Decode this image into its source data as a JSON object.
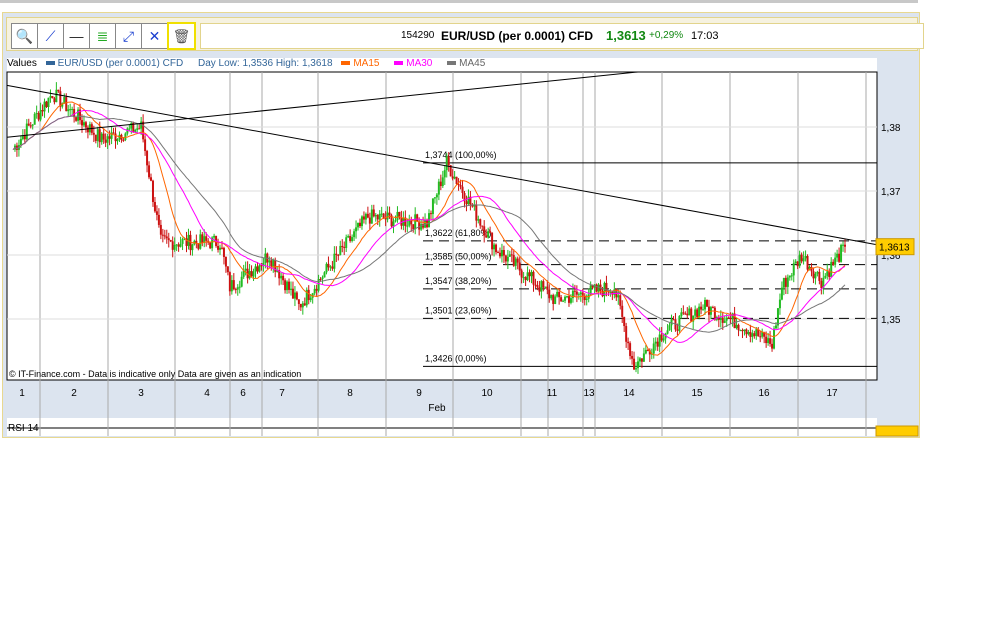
{
  "toolbar": {
    "buttons": [
      "zoom-in",
      "draw-trendline",
      "horizontal-line",
      "fibonacci",
      "parallel-channel",
      "crossing-lines",
      "delete"
    ]
  },
  "quote": {
    "id": "154290",
    "symbol": "EUR/USD (per 0.0001) CFD",
    "price": "1,3613",
    "change": "+0,29%",
    "time": "17:03"
  },
  "legend": {
    "label": "Values",
    "series": "EUR/USD (per 0.0001) CFD",
    "day_low_high": "Day Low: 1,3536 High: 1,3618",
    "ma15": "MA15",
    "ma30": "MA30",
    "ma45": "MA45"
  },
  "colors": {
    "up": "#22bb22",
    "down": "#cc1111",
    "ma15": "#ff6600",
    "ma30": "#ff00ff",
    "ma45": "#777777",
    "series": "#336699"
  },
  "chart_data": {
    "type": "candlestick",
    "title": "EUR/USD (per 0.0001) CFD",
    "ylim": [
      1.3405,
      1.3895
    ],
    "y_ticks": [
      "1,38",
      "1,37",
      "1,36",
      "1,35"
    ],
    "y_tick_values": [
      1.38,
      1.37,
      1.36,
      1.35
    ],
    "x_ticks": [
      "1",
      "2",
      "3",
      "4",
      "6",
      "7",
      "8",
      "9",
      "10",
      "11",
      "13",
      "14",
      "15",
      "16",
      "17"
    ],
    "x_month": "Feb",
    "last_price_label": "1,3613",
    "last_price": 1.3613,
    "price_path": [
      [
        0,
        1.3765
      ],
      [
        20,
        1.3853
      ],
      [
        45,
        1.378
      ],
      [
        65,
        1.38
      ],
      [
        75,
        1.362
      ],
      [
        105,
        1.362
      ],
      [
        110,
        1.355
      ],
      [
        130,
        1.36
      ],
      [
        145,
        1.352
      ],
      [
        165,
        1.36
      ],
      [
        180,
        1.366
      ],
      [
        210,
        1.365
      ],
      [
        220,
        1.3744
      ],
      [
        245,
        1.361
      ],
      [
        275,
        1.353
      ],
      [
        305,
        1.355
      ],
      [
        315,
        1.3426
      ],
      [
        330,
        1.348
      ],
      [
        350,
        1.352
      ],
      [
        370,
        1.349
      ],
      [
        385,
        1.346
      ],
      [
        390,
        1.355
      ],
      [
        400,
        1.36
      ],
      [
        410,
        1.356
      ],
      [
        422,
        1.3613
      ]
    ],
    "fibonacci": [
      {
        "label": "1,3744 (100,00%)",
        "value": 1.3744
      },
      {
        "label": "1,3622 (61,80%)",
        "value": 1.3622
      },
      {
        "label": "1,3585 (50,00%)",
        "value": 1.3585
      },
      {
        "label": "1,3547 (38,20%)",
        "value": 1.3547
      },
      {
        "label": "1,3501 (23,60%)",
        "value": 1.3501
      },
      {
        "label": "1,3426 (0,00%)",
        "value": 1.3426
      }
    ],
    "trendlines": [
      {
        "from": 1.3865,
        "to": 1.3616
      },
      {
        "from": 1.3784,
        "to": 1.3886
      }
    ],
    "footnote": "© IT-Finance.com - Data is indicative only Data are given as an indication",
    "sub_panel": "RSI 14"
  }
}
